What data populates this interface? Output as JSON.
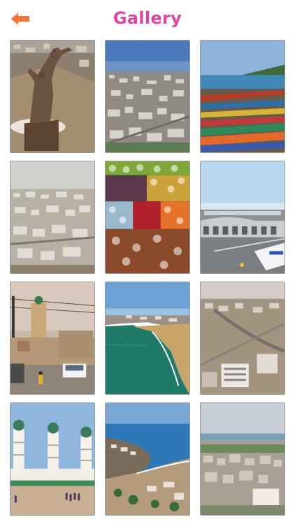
{
  "header": {
    "title": "Gallery",
    "back_icon": "arrow-left-icon",
    "accent_color": "#e0469f",
    "back_color": "#f4753a"
  },
  "gallery": {
    "items": [
      {
        "subject": "monument-statue"
      },
      {
        "subject": "city-aerial"
      },
      {
        "subject": "fishing-boats"
      },
      {
        "subject": "city-hazy"
      },
      {
        "subject": "fruit-market"
      },
      {
        "subject": "airport-terminal"
      },
      {
        "subject": "street-mosque"
      },
      {
        "subject": "coastline-beach"
      },
      {
        "subject": "city-highway"
      },
      {
        "subject": "mosque-towers"
      },
      {
        "subject": "coastal-town"
      },
      {
        "subject": "city-buildings"
      }
    ]
  }
}
